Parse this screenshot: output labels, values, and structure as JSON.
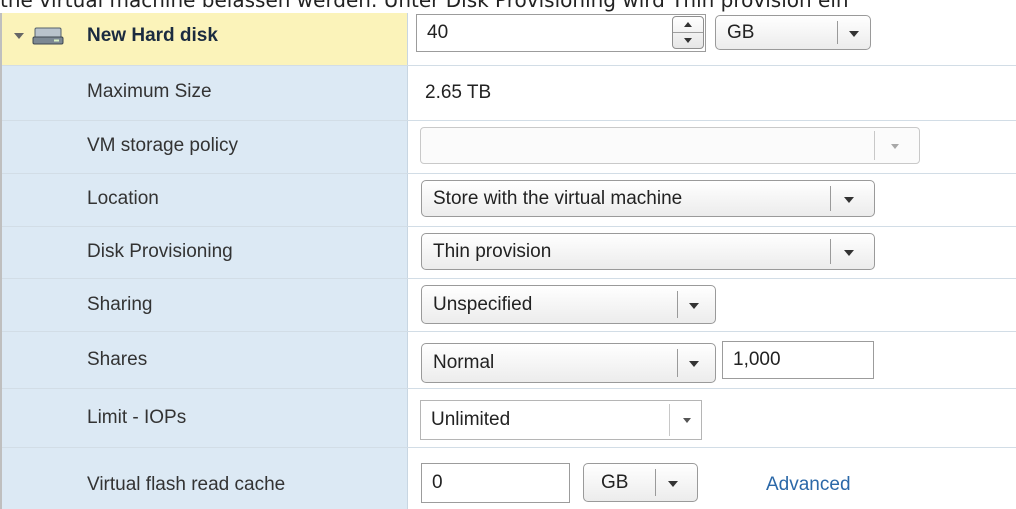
{
  "top_caption": "the virtual machine belassen werden. Unter Disk Provisioning wird Thin provision ein",
  "hard_disk": {
    "title": "New Hard disk",
    "size_value": "40",
    "size_unit": "GB"
  },
  "rows": {
    "max_size": {
      "label": "Maximum Size",
      "value": "2.65 TB"
    },
    "storage_policy": {
      "label": "VM storage policy",
      "value": ""
    },
    "location": {
      "label": "Location",
      "value": "Store with the virtual machine"
    },
    "provisioning": {
      "label": "Disk Provisioning",
      "value": "Thin provision"
    },
    "sharing": {
      "label": "Sharing",
      "value": "Unspecified"
    },
    "shares": {
      "label": "Shares",
      "value": "Normal",
      "amount": "1,000"
    },
    "limit_iops": {
      "label": "Limit - IOPs",
      "value": "Unlimited"
    },
    "flash_cache": {
      "label": "Virtual flash read cache",
      "value": "0",
      "unit": "GB",
      "link": "Advanced"
    }
  },
  "icons": {
    "expand": "chevron-down-icon",
    "disk": "hard-disk-icon"
  },
  "colors": {
    "label_column_bg": "#dce9f4",
    "header_highlight_bg": "#fbf3ba",
    "link": "#2b68a8"
  }
}
